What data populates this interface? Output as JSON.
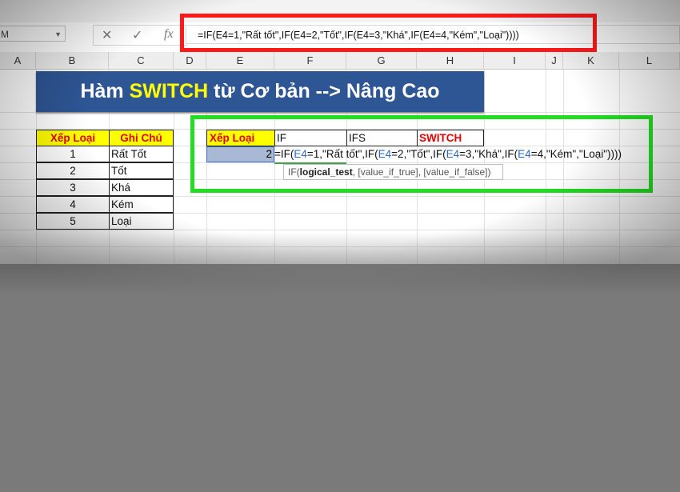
{
  "namebox": {
    "value": "M",
    "dropdown_icon": "chevron-down-icon"
  },
  "formula_bar": {
    "cancel_icon": "✕",
    "enter_icon": "✓",
    "fx_label": "fx",
    "formula": "=IF(E4=1,\"Rất tốt\",IF(E4=2,\"Tốt\",IF(E4=3,\"Khá\",IF(E4=4,\"Kém\",\"Loại\"))))"
  },
  "columns": [
    "A",
    "B",
    "C",
    "D",
    "E",
    "F",
    "G",
    "H",
    "I",
    "J",
    "K",
    "L"
  ],
  "banner": {
    "part1": "Hàm ",
    "highlight": "SWITCH",
    "part2": " từ Cơ bản --> Nâng Cao"
  },
  "left_table": {
    "headers": [
      "Xếp Loại",
      "Ghi Chú"
    ],
    "rows": [
      [
        "1",
        "Rất Tốt"
      ],
      [
        "2",
        "Tốt"
      ],
      [
        "3",
        "Khá"
      ],
      [
        "4",
        "Kém"
      ],
      [
        "5",
        "Loại"
      ]
    ]
  },
  "right_table": {
    "headers": [
      "Xếp Loại",
      "IF",
      "IFS",
      "SWITCH"
    ],
    "selected_value": "2",
    "edit_formula_parts": [
      "=IF(",
      "E4",
      "=1,\"Rất tốt\",IF(",
      "E4",
      "=2,\"Tốt\",IF(",
      "E4",
      "=3,\"Khá\",IF(",
      "E4",
      "=4,\"Kém\",\"Loại\"))))"
    ],
    "tooltip": {
      "func": "IF(",
      "arg1": "logical_test",
      "rest": ", [value_if_true], [value_if_false])"
    }
  },
  "colors": {
    "highlight_red": "#ff1a1a",
    "highlight_green": "#22dd22",
    "banner_bg": "#2e5594",
    "header_yellow": "#ffff00"
  }
}
